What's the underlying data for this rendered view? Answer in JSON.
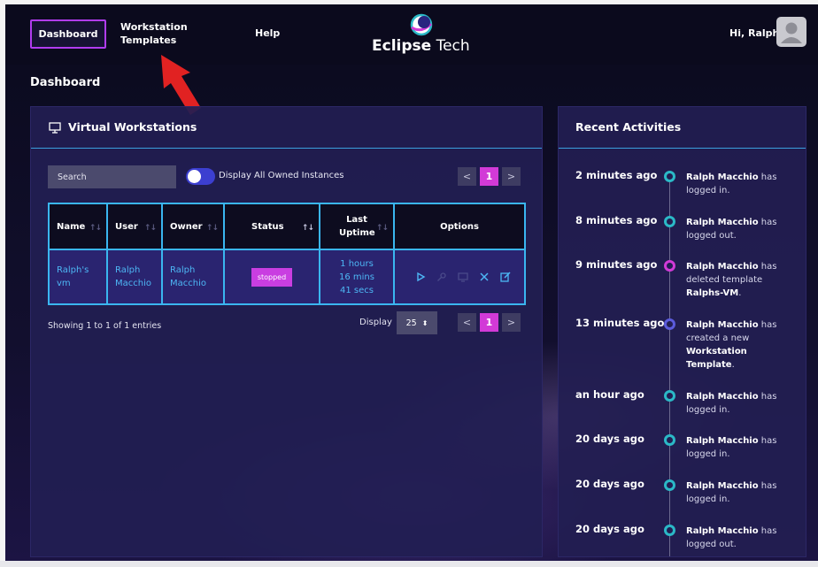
{
  "nav": {
    "dashboard_label": "Dashboard",
    "templates_label_line1": "Workstation",
    "templates_label_line2": "Templates",
    "help_label": "Help",
    "logo_bold": "Eclipse",
    "logo_rest": " Tech",
    "greeting": "Hi, Ralph"
  },
  "page": {
    "title": "Dashboard"
  },
  "workstations": {
    "title": "Virtual Workstations",
    "search_placeholder": "Search",
    "toggle_label": "Display All Owned Instances",
    "pager": {
      "prev": "<",
      "current": "1",
      "next": ">"
    },
    "columns": [
      "Name",
      "User",
      "Owner",
      "Status",
      "Last Uptime",
      "Options"
    ],
    "rows": [
      {
        "name": "Ralph's vm",
        "user": "Ralph Macchio",
        "owner": "Ralph Macchio",
        "status": "stopped",
        "last_uptime": "1 hours 16 mins 41 secs"
      }
    ],
    "showing": "Showing 1 to 1 of 1 entries",
    "display_label": "Display",
    "display_value": "25"
  },
  "activities": {
    "title": "Recent Activities",
    "items": [
      {
        "time": "2 minutes ago",
        "actor": "Ralph Macchio",
        "text": " has logged in.",
        "color": "#2bb9c7"
      },
      {
        "time": "8 minutes ago",
        "actor": "Ralph Macchio",
        "text": " has logged out.",
        "color": "#2bb9c7"
      },
      {
        "time": "9 minutes ago",
        "actor": "Ralph Macchio",
        "text": " has deleted template ",
        "target": "Ralphs-VM",
        "tail": ".",
        "color": "#d23ad7"
      },
      {
        "time": "13 minutes ago",
        "actor": "Ralph Macchio",
        "text": " has created a new ",
        "target": "Workstation Template",
        "tail": ".",
        "color": "#5b5bdc"
      },
      {
        "time": "an hour ago",
        "actor": "Ralph Macchio",
        "text": " has logged in.",
        "color": "#2bb9c7"
      },
      {
        "time": "20 days ago",
        "actor": "Ralph Macchio",
        "text": " has logged in.",
        "color": "#2bb9c7"
      },
      {
        "time": "20 days ago",
        "actor": "Ralph Macchio",
        "text": " has logged in.",
        "color": "#2bb9c7"
      },
      {
        "time": "20 days ago",
        "actor": "Ralph Macchio",
        "text": " has logged out.",
        "color": "#2bb9c7"
      }
    ]
  },
  "colors": {
    "accent": "#d23ad7",
    "table_border": "#3ab6f0",
    "link": "#4db7f5",
    "toggle": "#3c3fd0"
  }
}
